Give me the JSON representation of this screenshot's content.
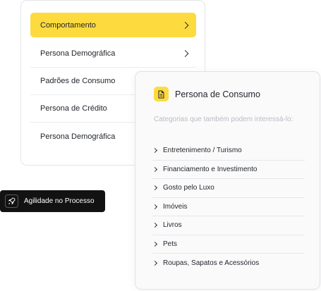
{
  "menu": {
    "items": [
      {
        "label": "Comportamento"
      },
      {
        "label": "Persona Demográfica"
      },
      {
        "label": "Padrões de Consumo"
      },
      {
        "label": "Persona de Crédito"
      },
      {
        "label": "Persona Demográfica"
      }
    ]
  },
  "persona": {
    "title": "Persona de Consumo",
    "subtitle": "Categorias que também podem interessá-lo:",
    "icon": "document-icon",
    "categories": [
      {
        "label": "Entretenimento / Turismo"
      },
      {
        "label": "Financiamento e Investimento"
      },
      {
        "label": "Gosto pelo Luxo"
      },
      {
        "label": "Imóveis"
      },
      {
        "label": "Livros"
      },
      {
        "label": "Pets"
      },
      {
        "label": "Roupas, Sapatos e Acessórios"
      }
    ]
  },
  "chip": {
    "label": "Agilidade no Processo",
    "icon": "rocket-icon"
  },
  "colors": {
    "accent": "#fddb3f",
    "chip_bg": "#121212"
  }
}
